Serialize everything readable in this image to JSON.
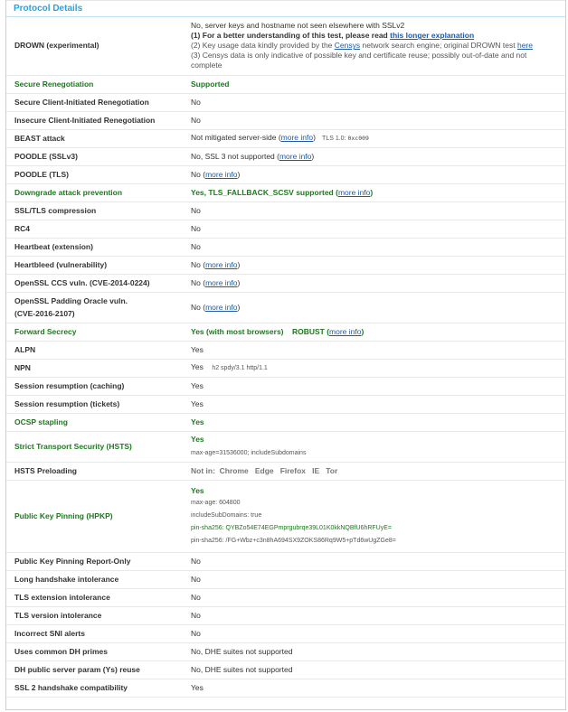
{
  "section_title": "Protocol Details",
  "drown": {
    "label": "DROWN (experimental)",
    "line1": "No, server keys and hostname not seen elsewhere with SSLv2",
    "line2_text": "(1) For a better understanding of this test, please read ",
    "line2_link": "this longer explanation",
    "line3_text_a": "(2) Key usage data kindly provided by the ",
    "line3_link_a": "Censys",
    "line3_text_b": " network search engine; original DROWN test ",
    "line3_link_b": "here",
    "line4": "(3) Censys data is only indicative of possible key and certificate reuse; possibly out-of-date and not",
    "line5": "complete"
  },
  "rows": {
    "secure_reneg": {
      "label": "Secure Renegotiation",
      "value": "Supported"
    },
    "secure_client_reneg": {
      "label": "Secure Client-Initiated Renegotiation",
      "value": "No"
    },
    "insecure_client_reneg": {
      "label": "Insecure Client-Initiated Renegotiation",
      "value": "No"
    },
    "beast": {
      "label": "BEAST attack",
      "value": "Not mitigated server-side (",
      "link": "more info",
      "close": ")",
      "extra": "TLS 1.0: ",
      "extra_code": "0xc009"
    },
    "poodle_ssl": {
      "label": "POODLE (SSLv3)",
      "value": "No, SSL 3 not supported (",
      "link": "more info",
      "close": ")"
    },
    "poodle_tls": {
      "label": "POODLE (TLS)",
      "value": "No (",
      "link": "more info",
      "close": ")"
    },
    "downgrade": {
      "label": "Downgrade attack prevention",
      "value": "Yes, TLS_FALLBACK_SCSV supported (",
      "link": "more info",
      "close": ")"
    },
    "compression": {
      "label": "SSL/TLS compression",
      "value": "No"
    },
    "rc4": {
      "label": "RC4",
      "value": "No"
    },
    "heartbeat": {
      "label": "Heartbeat (extension)",
      "value": "No"
    },
    "heartbleed": {
      "label": "Heartbleed (vulnerability)",
      "value": "No (",
      "link": "more info",
      "close": ")"
    },
    "ccs": {
      "label": "OpenSSL CCS vuln. (CVE-2014-0224)",
      "value": "No (",
      "link": "more info",
      "close": ")"
    },
    "padding_oracle": {
      "label_line1": "OpenSSL Padding Oracle vuln.",
      "label_line2": "(CVE-2016-2107)",
      "value": "No (",
      "link": "more info",
      "close": ")"
    },
    "forward_secrecy": {
      "label": "Forward Secrecy",
      "value": "Yes (with most browsers)",
      "robust": "ROBUST",
      "open": " (",
      "link": "more info",
      "close": ")"
    },
    "alpn": {
      "label": "ALPN",
      "value": "Yes"
    },
    "npn": {
      "label": "NPN",
      "value": "Yes",
      "extra": "h2 spdy/3.1 http/1.1"
    },
    "session_caching": {
      "label": "Session resumption (caching)",
      "value": "Yes"
    },
    "session_tickets": {
      "label": "Session resumption (tickets)",
      "value": "Yes"
    },
    "ocsp": {
      "label": "OCSP stapling",
      "value": "Yes"
    },
    "hsts": {
      "label": "Strict Transport Security (HSTS)",
      "value": "Yes",
      "detail": "max-age=31536000; includeSubdomains"
    },
    "hsts_preload": {
      "label": "HSTS Preloading",
      "value": "Not in:  Chrome   Edge   Firefox   IE   Tor"
    },
    "hpkp": {
      "label": "Public Key Pinning (HPKP)",
      "value": "Yes",
      "d1": "max-age: 604800",
      "d2": "includeSubDomains: true",
      "d3": "pin-sha256: QYBZo54E74EGPmprgubrqe39L01K0kkNQBfU6hRFUyE=",
      "d4": "pin-sha256: /FG+Wbz+c3n8hA694SX9ZOKS86Rq9W5+pTd6wUgZGe8="
    },
    "hpkp_report": {
      "label": "Public Key Pinning Report-Only",
      "value": "No"
    },
    "long_handshake": {
      "label": "Long handshake intolerance",
      "value": "No"
    },
    "tls_ext_intol": {
      "label": "TLS extension intolerance",
      "value": "No"
    },
    "tls_ver_intol": {
      "label": "TLS version intolerance",
      "value": "No"
    },
    "sni_alerts": {
      "label": "Incorrect SNI alerts",
      "value": "No"
    },
    "dh_primes": {
      "label": "Uses common DH primes",
      "value": "No, DHE suites not supported"
    },
    "dh_reuse": {
      "label": "DH public server param (Ys) reuse",
      "value": "No, DHE suites not supported"
    },
    "ssl2_compat": {
      "label": "SSL 2 handshake compatibility",
      "value": "Yes"
    }
  },
  "colors": {
    "accent": "#2aa1dc",
    "good": "#1a7a1a",
    "link": "#1f5aa6",
    "muted": "#777777"
  }
}
